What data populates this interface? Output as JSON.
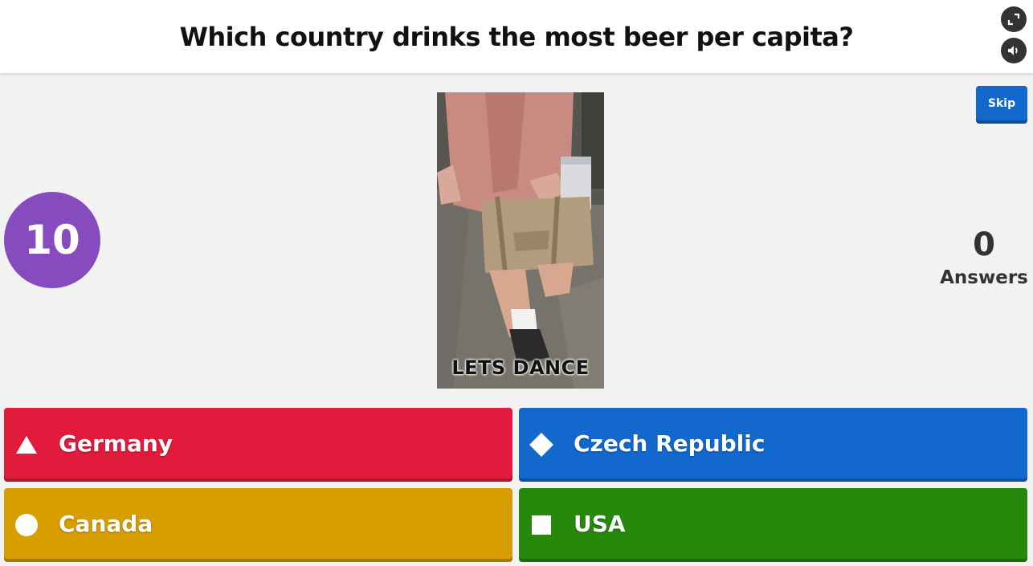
{
  "question": "Which country drinks the most beer per capita?",
  "header": {
    "fullscreen_icon": "fullscreen-icon",
    "sound_icon": "speaker-icon"
  },
  "skip_label": "Skip",
  "timer": "10",
  "answers_count": "0",
  "answers_label": "Answers",
  "media": {
    "caption": "LETS DANCE"
  },
  "options": [
    {
      "label": "Germany",
      "shape": "triangle-icon",
      "color": "#e21b3c"
    },
    {
      "label": "Czech Republic",
      "shape": "diamond-icon",
      "color": "#1368ce"
    },
    {
      "label": "Canada",
      "shape": "circle-icon",
      "color": "#d89e00"
    },
    {
      "label": "USA",
      "shape": "square-icon",
      "color": "#26890c"
    }
  ],
  "colors": {
    "timer": "#864cbf",
    "skip": "#1368ce",
    "background": "#f2f2f2"
  }
}
